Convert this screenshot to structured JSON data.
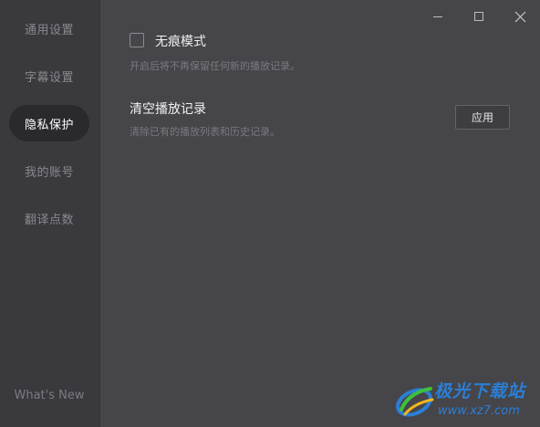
{
  "sidebar": {
    "items": [
      {
        "label": "通用设置",
        "active": false
      },
      {
        "label": "字幕设置",
        "active": false
      },
      {
        "label": "隐私保护",
        "active": true
      },
      {
        "label": "我的账号",
        "active": false
      },
      {
        "label": "翻译点数",
        "active": false
      }
    ],
    "whats_new": "What's New"
  },
  "window_controls": {
    "minimize": "minimize-icon",
    "maximize": "maximize-icon",
    "close": "close-icon"
  },
  "privacy": {
    "incognito": {
      "title": "无痕模式",
      "description": "开启后将不再保留任何新的播放记录。",
      "checked": false
    },
    "clear_history": {
      "title": "清空播放记录",
      "description": "清除已有的播放列表和历史记录。",
      "button_label": "应用"
    }
  },
  "watermark": {
    "title": "极光下载站",
    "url": "www.xz7.com"
  },
  "colors": {
    "background": "#46454a",
    "sidebar": "#3a393e",
    "active_pill": "#2a292d",
    "watermark": "#2a7fd6"
  }
}
